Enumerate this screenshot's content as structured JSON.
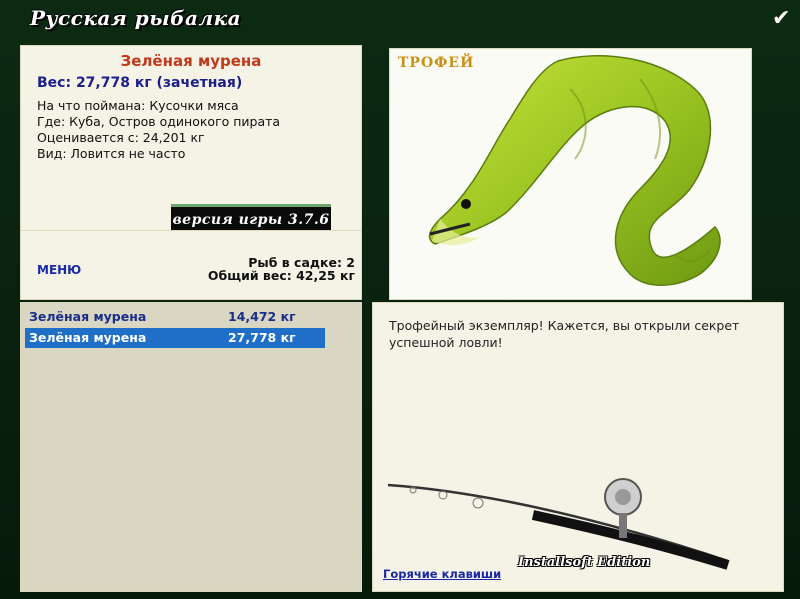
{
  "window": {
    "title": "Русская рыбалка",
    "close_symbol": "✔"
  },
  "info": {
    "fish_name": "Зелёная мурена",
    "weight": "Вес: 27,778 кг (зачетная)",
    "bait": "На что поймана: Кусочки мяса",
    "location": "Где: Куба, Остров одинокого пирата",
    "rated_from": "Оценивается с: 24,201 кг",
    "type": "Вид: Ловится не часто",
    "version": "версия игры 3.7.6"
  },
  "stats": {
    "menu_label": "МЕНЮ",
    "fish_in_keepnet": "Рыб в садке: 2",
    "total_weight": "Общий вес: 42,25 кг"
  },
  "trophy": {
    "label": "ТРОФЕЙ"
  },
  "catch_list": [
    {
      "name": "Зелёная мурена",
      "weight": "14,472 кг",
      "selected": false
    },
    {
      "name": "Зелёная мурена",
      "weight": "27,778 кг",
      "selected": true
    }
  ],
  "description": {
    "text": "Трофейный экземпляр! Кажется, вы открыли секрет успешной ловли!",
    "hotkeys_link": "Горячие клавиши",
    "edition": "Installsoft Edition"
  },
  "colors": {
    "selected_row": "#1f6fc9",
    "fish_name": "#c0391b",
    "link": "#1a28a8"
  }
}
